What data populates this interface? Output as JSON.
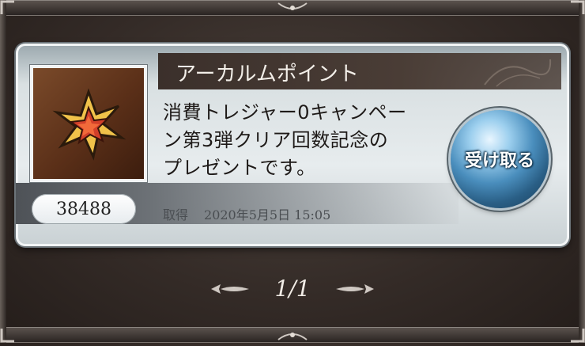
{
  "reward": {
    "title": "アーカルムポイント",
    "message_lines": [
      "消費トレジャー0キャンペー",
      "ン第3弾クリア回数記念の",
      "プレゼントです。"
    ],
    "count": "38488",
    "acquired_label": "取得",
    "acquired_date": "2020年5月5日 15:05",
    "icon": "arcarum-star-icon"
  },
  "receive_button": {
    "label": "受け取る"
  },
  "pager": {
    "text": "1/1"
  },
  "colors": {
    "header_bar": "#3b302b",
    "card_bg": "#e7ecee",
    "button_blue": "#4a8ebd",
    "icon_bg": "#5a2f18"
  }
}
